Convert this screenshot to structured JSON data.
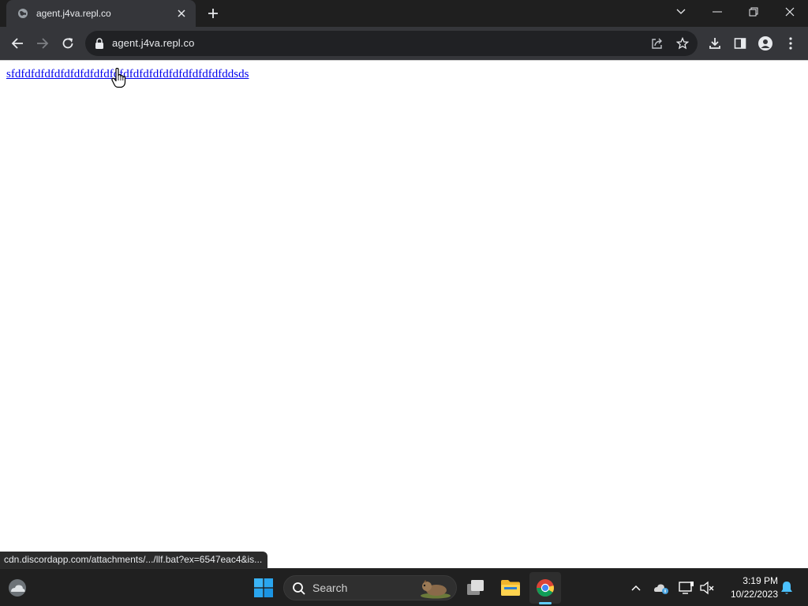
{
  "browser": {
    "tab": {
      "title": "agent.j4va.repl.co"
    },
    "address_bar": {
      "url": "agent.j4va.repl.co"
    },
    "status_url": "cdn.discordapp.com/attachments/.../llf.bat?ex=6547eac4&is..."
  },
  "page": {
    "link_text": "sfdfdfdfdfdfdfdfdfdfdfdfdfdfdfdfdfdfdfdfdfdfddsds"
  },
  "taskbar": {
    "search_placeholder": "Search",
    "clock": {
      "time": "3:19 PM",
      "date": "10/22/2023"
    }
  },
  "colors": {
    "tab_strip": "#1f1f1f",
    "toolbar": "#35363a",
    "link": "#0000ee",
    "taskbar": "#202020",
    "accent": "#60cdff"
  },
  "icons": [
    "globe-icon",
    "close-icon",
    "plus-icon",
    "chevron-down-icon",
    "minimize-icon",
    "restore-icon",
    "back-arrow-icon",
    "forward-arrow-icon",
    "reload-icon",
    "lock-icon",
    "share-icon",
    "star-icon",
    "download-icon",
    "side-panel-icon",
    "profile-icon",
    "kebab-menu-icon",
    "hand-cursor-icon",
    "weather-icon",
    "windows-start-icon",
    "search-icon",
    "task-view-icon",
    "file-explorer-icon",
    "chrome-icon",
    "chevron-up-icon",
    "onedrive-icon",
    "network-icon",
    "speaker-muted-icon",
    "bell-icon"
  ]
}
